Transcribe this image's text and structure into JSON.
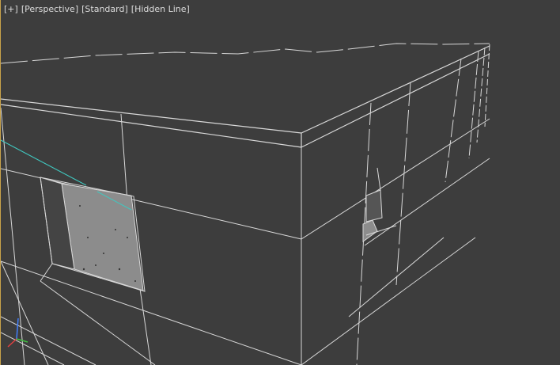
{
  "viewport": {
    "menus": {
      "plus": "+",
      "view": "Perspective",
      "shading": "Standard",
      "style": "Hidden Line"
    },
    "colors": {
      "background": "#3d3d3d",
      "wire": "#d8d8d8",
      "window_fill": "#8c8c8c",
      "active_border": "#c8a24a",
      "selection_line": "#40c8c0"
    },
    "axis_gizmo": {
      "axes": [
        "x",
        "y",
        "z"
      ],
      "colors": {
        "x": "#e04040",
        "y": "#40c040",
        "z": "#4080ff"
      }
    }
  }
}
